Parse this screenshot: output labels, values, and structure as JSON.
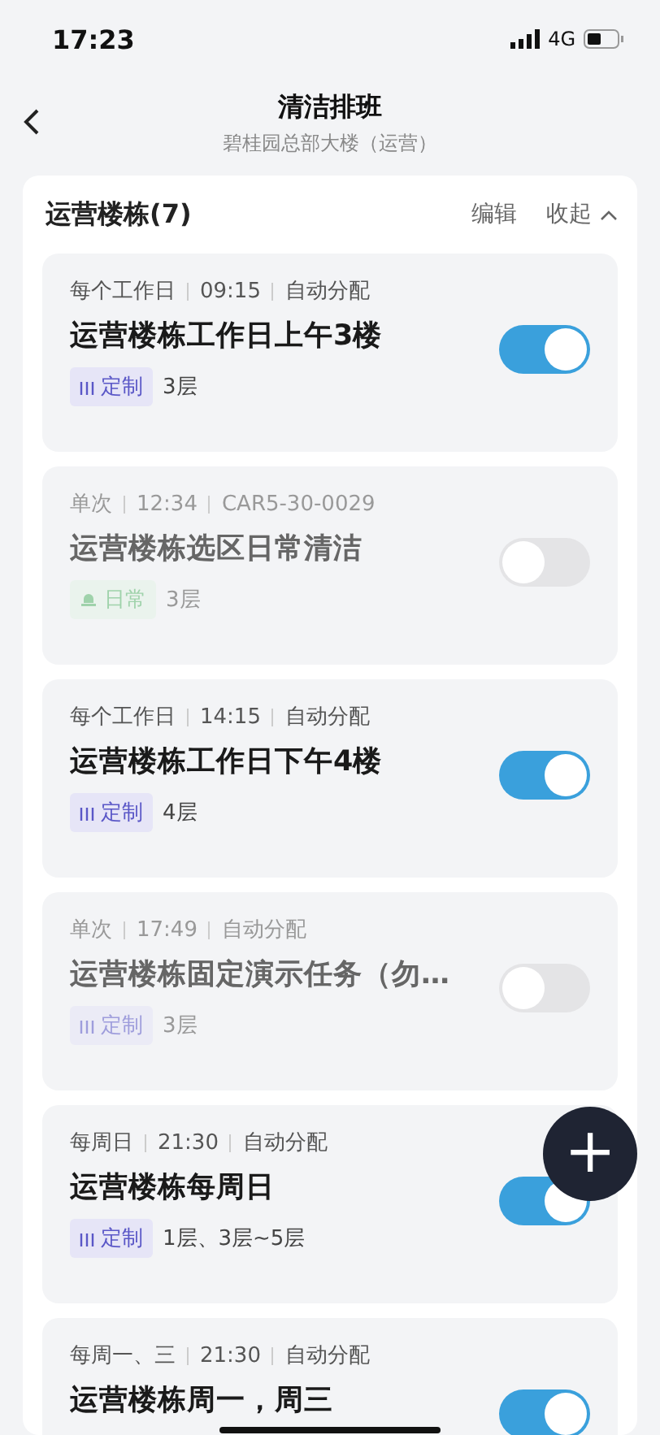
{
  "status_bar": {
    "time": "17:23",
    "network": "4G"
  },
  "header": {
    "title": "清洁排班",
    "subtitle": "碧桂园总部大楼（运营）"
  },
  "section": {
    "title": "运营楼栋(7)",
    "actions": [
      "编辑",
      "收起"
    ],
    "expanded": true
  },
  "tasks": [
    {
      "meta": [
        "每个工作日",
        "09:15",
        "自动分配"
      ],
      "title": "运营楼栋工作日上午3楼",
      "tag": {
        "kind": "custom",
        "label": "定制"
      },
      "floors": "3层",
      "on": true
    },
    {
      "meta": [
        "单次",
        "12:34",
        "CAR5-30-0029"
      ],
      "title": "运营楼栋选区日常清洁",
      "tag": {
        "kind": "daily",
        "label": "日常"
      },
      "floors": "3层",
      "on": false
    },
    {
      "meta": [
        "每个工作日",
        "14:15",
        "自动分配"
      ],
      "title": "运营楼栋工作日下午4楼",
      "tag": {
        "kind": "custom",
        "label": "定制"
      },
      "floors": "4层",
      "on": true
    },
    {
      "meta": [
        "单次",
        "17:49",
        "自动分配"
      ],
      "title": "运营楼栋固定演示任务（勿…",
      "tag": {
        "kind": "custom",
        "label": "定制"
      },
      "floors": "3层",
      "on": false
    },
    {
      "meta": [
        "每周日",
        "21:30",
        "自动分配"
      ],
      "title": "运营楼栋每周日",
      "tag": {
        "kind": "custom",
        "label": "定制"
      },
      "floors": "1层、3层~5层",
      "on": true
    },
    {
      "meta": [
        "每周一、三",
        "21:30",
        "自动分配"
      ],
      "title": "运营楼栋周一，周三",
      "on": true
    }
  ],
  "fab": {
    "symbol": "+"
  }
}
